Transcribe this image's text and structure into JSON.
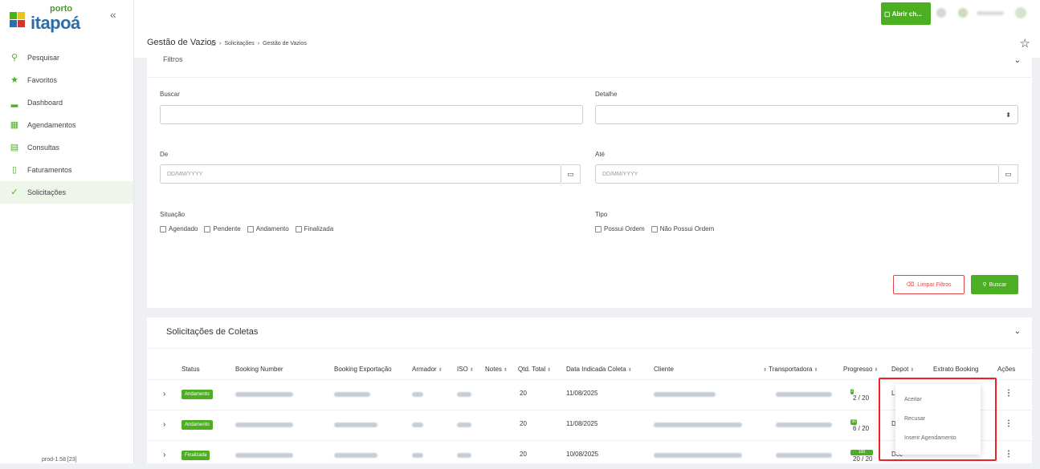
{
  "logo": {
    "top": "porto",
    "main": "itapoá"
  },
  "sidebar": {
    "collapse_icon": "«",
    "items": [
      {
        "label": "Pesquisar",
        "icon": "search-icon",
        "glyph": "⚲"
      },
      {
        "label": "Favoritos",
        "icon": "star-icon",
        "glyph": "★"
      },
      {
        "label": "Dashboard",
        "icon": "chart-icon",
        "glyph": "▂"
      },
      {
        "label": "Agendamentos",
        "icon": "calendar-icon",
        "glyph": "▦"
      },
      {
        "label": "Consultas",
        "icon": "table-icon",
        "glyph": "▤"
      },
      {
        "label": "Faturamentos",
        "icon": "document-icon",
        "glyph": "▯"
      },
      {
        "label": "Solicitações",
        "icon": "check-icon",
        "glyph": "✓"
      }
    ],
    "active": "Solicitações",
    "version": "prod-1.58 [23]"
  },
  "topbar": {
    "abrir_label": "Abrir ch..."
  },
  "header": {
    "title": "Gestão de Vazios",
    "breadcrumb": [
      "Solicitações",
      "Gestão de Vazios"
    ]
  },
  "filtros": {
    "title": "Filtros",
    "buscar_label": "Buscar",
    "buscar_value": "",
    "detalhe_label": "Detalhe",
    "de_label": "De",
    "de_placeholder": "DD/MM/YYYY",
    "ate_label": "Até",
    "ate_placeholder": "DD/MM/YYYY",
    "situacao_label": "Situação",
    "situacao_options": [
      "Agendado",
      "Pendente",
      "Andamento",
      "Finalizada"
    ],
    "tipo_label": "Tipo",
    "tipo_options": [
      "Possui Ordem",
      "Não Possui Ordem"
    ],
    "limpar_label": "Limpar Filtros",
    "buscar_button": "Buscar"
  },
  "coletas": {
    "title": "Solicitações de Coletas",
    "columns": [
      "Status",
      "Booking Number",
      "Booking Exportação",
      "Armador",
      "ISO",
      "Notes",
      "Qtd. Total",
      "Data Indicada Coleta",
      "Cliente",
      "Transportadora",
      "Progresso",
      "Depot",
      "Extrato Booking",
      "Ações"
    ],
    "rows": [
      {
        "status": "Andamento",
        "qtd": "20",
        "data": "11/08/2025",
        "progresso": "2 / 20",
        "progress_fraction": 0.1,
        "bar_label": "2",
        "depot": "Li"
      },
      {
        "status": "Andamento",
        "qtd": "20",
        "data": "11/08/2025",
        "progresso": "6 / 20",
        "progress_fraction": 0.3,
        "bar_label": "30",
        "depot": "D"
      },
      {
        "status": "Finalizada",
        "qtd": "20",
        "data": "10/08/2025",
        "progresso": "20 / 20",
        "progress_fraction": 1.0,
        "bar_label": "100",
        "depot": "Dcc"
      }
    ]
  },
  "context_menu": {
    "items": [
      "Aceitar",
      "Recusar",
      "Inserir Agendamento"
    ]
  },
  "colors": {
    "accent": "#4caf22",
    "danger": "#e04848",
    "highlight": "#e8232a"
  }
}
